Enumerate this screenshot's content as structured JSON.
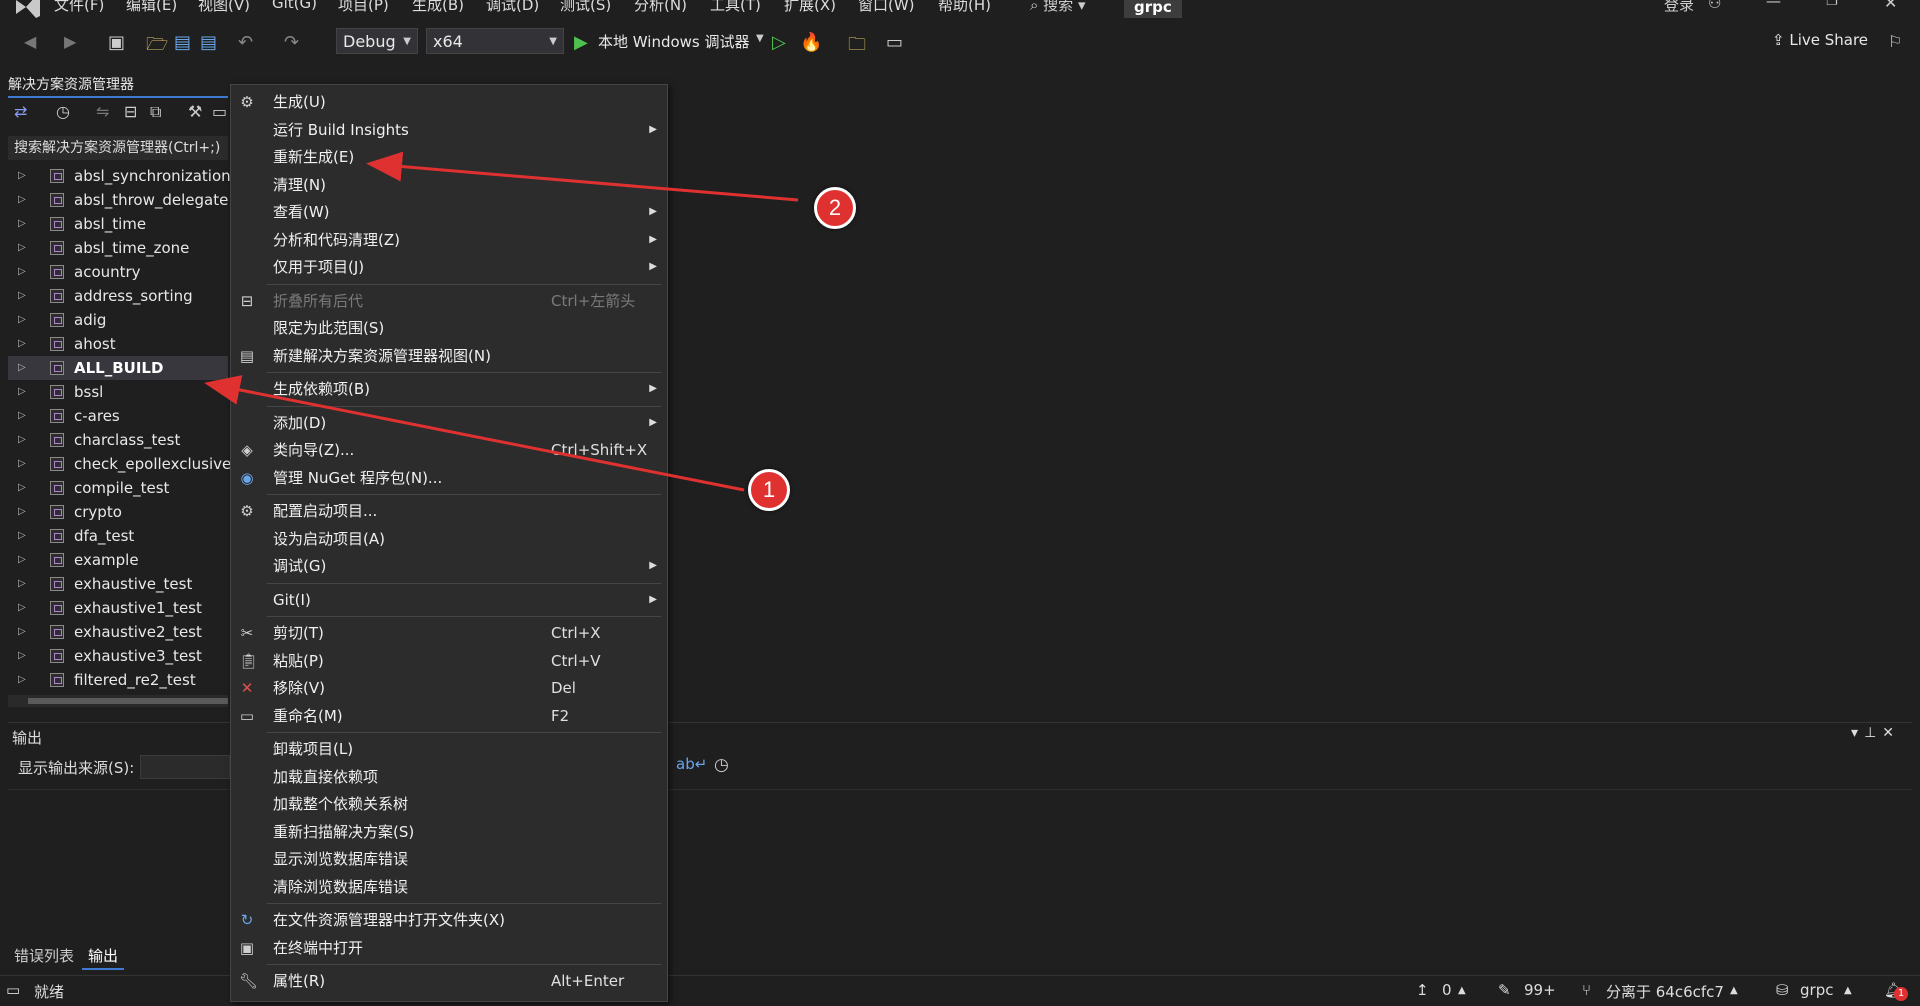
{
  "menubar": {
    "items": [
      "文件(F)",
      "编辑(E)",
      "视图(V)",
      "Git(G)",
      "项目(P)",
      "生成(B)",
      "调试(D)",
      "测试(S)",
      "分析(N)",
      "工具(T)",
      "扩展(X)",
      "窗口(W)",
      "帮助(H)"
    ],
    "search": "搜索",
    "project": "grpc",
    "login": "登录"
  },
  "toolbar": {
    "config": "Debug",
    "platform": "x64",
    "run_label": "本地 Windows 调试器",
    "live_share": "Live Share"
  },
  "solution_explorer": {
    "title": "解决方案资源管理器",
    "search_placeholder": "搜索解决方案资源管理器(Ctrl+;)",
    "items": [
      "absl_synchronization",
      "absl_throw_delegate",
      "absl_time",
      "absl_time_zone",
      "acountry",
      "address_sorting",
      "adig",
      "ahost",
      "ALL_BUILD",
      "bssl",
      "c-ares",
      "charclass_test",
      "check_epollexclusive",
      "compile_test",
      "crypto",
      "dfa_test",
      "example",
      "exhaustive_test",
      "exhaustive1_test",
      "exhaustive2_test",
      "exhaustive3_test",
      "filtered_re2_test"
    ],
    "selected": "ALL_BUILD"
  },
  "context_menu": {
    "items": [
      {
        "label": "生成(U)",
        "shortcut": "",
        "submenu": false,
        "icon": "build-icon"
      },
      {
        "label": "运行 Build Insights",
        "shortcut": "",
        "submenu": true,
        "icon": ""
      },
      {
        "label": "重新生成(E)",
        "shortcut": "",
        "submenu": false,
        "icon": ""
      },
      {
        "label": "清理(N)",
        "shortcut": "",
        "submenu": false,
        "icon": ""
      },
      {
        "label": "查看(W)",
        "shortcut": "",
        "submenu": true,
        "icon": ""
      },
      {
        "label": "分析和代码清理(Z)",
        "shortcut": "",
        "submenu": true,
        "icon": ""
      },
      {
        "label": "仅用于项目(J)",
        "shortcut": "",
        "submenu": true,
        "icon": ""
      },
      {
        "label": "折叠所有后代",
        "shortcut": "Ctrl+左箭头",
        "submenu": false,
        "icon": "collapse-icon",
        "disabled": true
      },
      {
        "label": "限定为此范围(S)",
        "shortcut": "",
        "submenu": false,
        "icon": ""
      },
      {
        "label": "新建解决方案资源管理器视图(N)",
        "shortcut": "",
        "submenu": false,
        "icon": "new-view-icon"
      },
      {
        "label": "生成依赖项(B)",
        "shortcut": "",
        "submenu": true,
        "icon": ""
      },
      {
        "label": "添加(D)",
        "shortcut": "",
        "submenu": true,
        "icon": ""
      },
      {
        "label": "类向导(Z)...",
        "shortcut": "Ctrl+Shift+X",
        "submenu": false,
        "icon": "class-wizard-icon"
      },
      {
        "label": "管理 NuGet 程序包(N)...",
        "shortcut": "",
        "submenu": false,
        "icon": "nuget-icon"
      },
      {
        "label": "配置启动项目...",
        "shortcut": "",
        "submenu": false,
        "icon": "gear-icon"
      },
      {
        "label": "设为启动项目(A)",
        "shortcut": "",
        "submenu": false,
        "icon": ""
      },
      {
        "label": "调试(G)",
        "shortcut": "",
        "submenu": true,
        "icon": ""
      },
      {
        "label": "Git(I)",
        "shortcut": "",
        "submenu": true,
        "icon": ""
      },
      {
        "label": "剪切(T)",
        "shortcut": "Ctrl+X",
        "submenu": false,
        "icon": "scissors-icon"
      },
      {
        "label": "粘贴(P)",
        "shortcut": "Ctrl+V",
        "submenu": false,
        "icon": "paste-icon"
      },
      {
        "label": "移除(V)",
        "shortcut": "Del",
        "submenu": false,
        "icon": "remove-icon"
      },
      {
        "label": "重命名(M)",
        "shortcut": "F2",
        "submenu": false,
        "icon": "rename-icon"
      },
      {
        "label": "卸载项目(L)",
        "shortcut": "",
        "submenu": false,
        "icon": ""
      },
      {
        "label": "加载直接依赖项",
        "shortcut": "",
        "submenu": false,
        "icon": ""
      },
      {
        "label": "加载整个依赖关系树",
        "shortcut": "",
        "submenu": false,
        "icon": ""
      },
      {
        "label": "重新扫描解决方案(S)",
        "shortcut": "",
        "submenu": false,
        "icon": ""
      },
      {
        "label": "显示浏览数据库错误",
        "shortcut": "",
        "submenu": false,
        "icon": ""
      },
      {
        "label": "清除浏览数据库错误",
        "shortcut": "",
        "submenu": false,
        "icon": ""
      },
      {
        "label": "在文件资源管理器中打开文件夹(X)",
        "shortcut": "",
        "submenu": false,
        "icon": "open-folder-icon"
      },
      {
        "label": "在终端中打开",
        "shortcut": "",
        "submenu": false,
        "icon": "terminal-icon"
      },
      {
        "label": "属性(R)",
        "shortcut": "Alt+Enter",
        "submenu": false,
        "icon": "wrench-icon"
      }
    ]
  },
  "output": {
    "title": "输出",
    "source_label": "显示输出来源(S):"
  },
  "bottom_tabs": [
    "错误列表",
    "输出"
  ],
  "status": {
    "ready": "就绪",
    "errors": "0",
    "changes": "99+",
    "branch_info": "分离于 64c6cfc7",
    "repo": "grpc",
    "notifications": "1"
  },
  "annotations": [
    "1",
    "2"
  ],
  "colors": {
    "accent": "#3e7ad1",
    "badge": "#e03131",
    "arrow": "#e03131"
  }
}
